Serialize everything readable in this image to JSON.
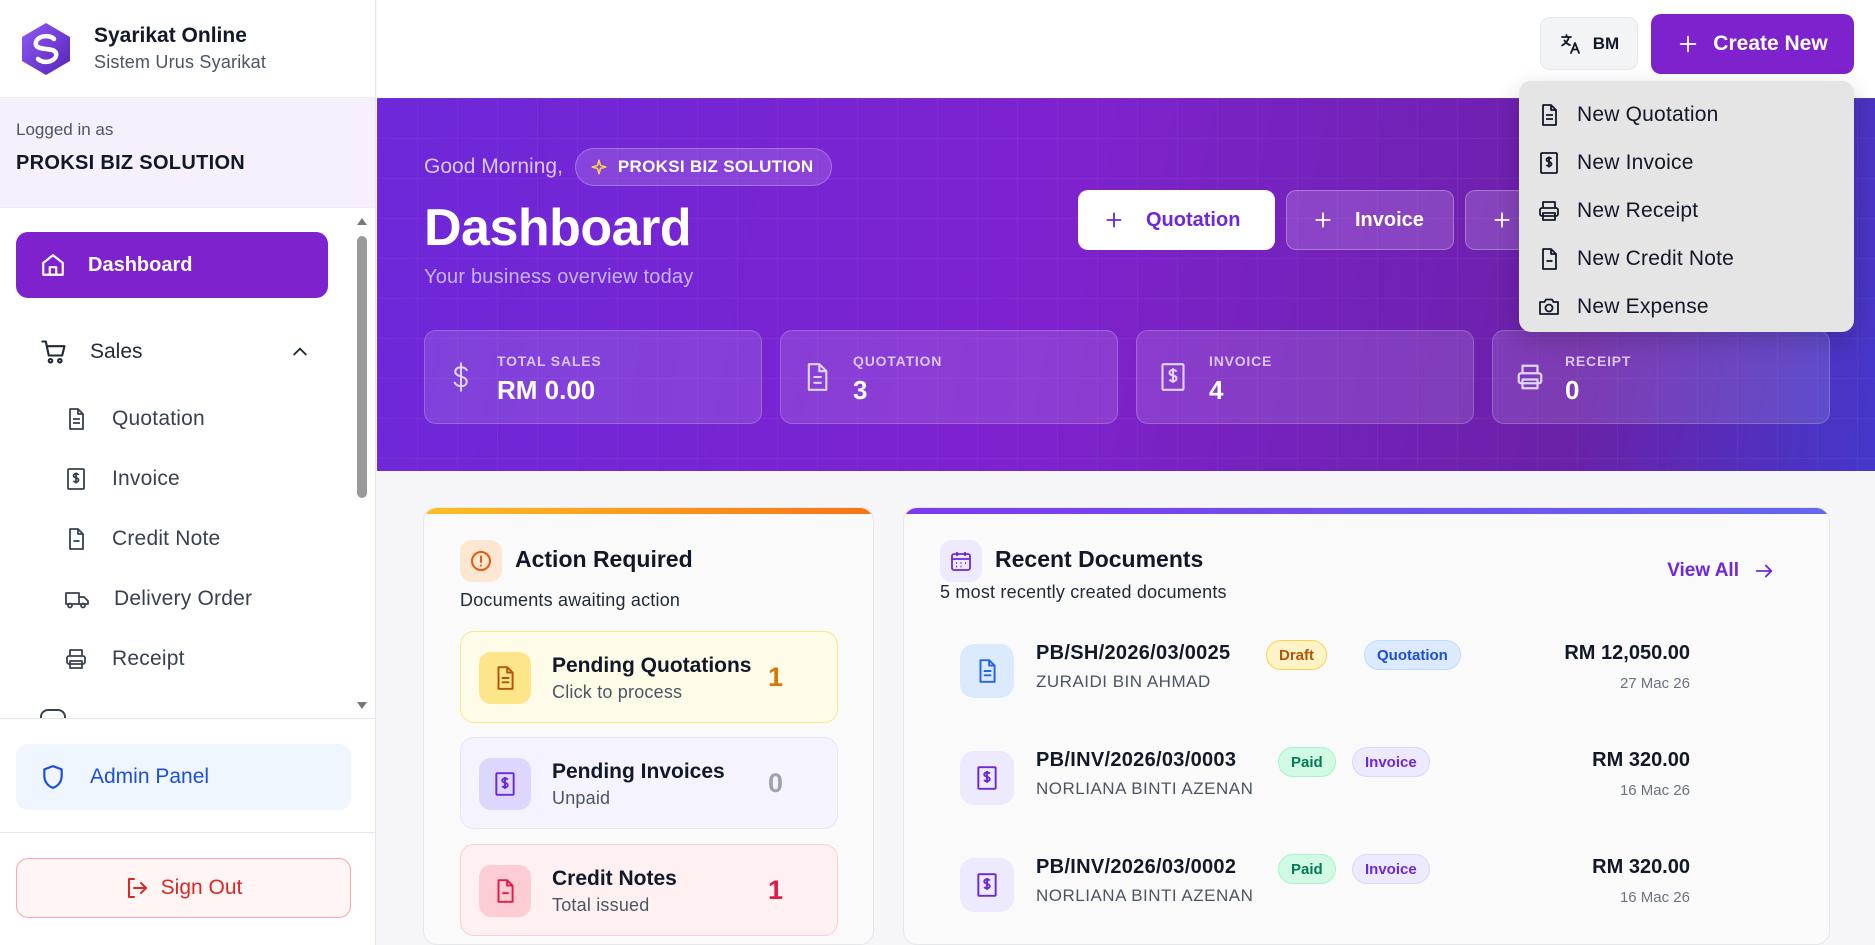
{
  "brand": {
    "name": "Syarikat Online",
    "subtitle": "Sistem Urus Syarikat"
  },
  "session": {
    "label": "Logged in as",
    "company": "PROKSI BIZ SOLUTION"
  },
  "nav": {
    "dashboard": "Dashboard",
    "sales": "Sales",
    "sales_items": [
      "Quotation",
      "Invoice",
      "Credit Note",
      "Delivery Order",
      "Receipt"
    ],
    "admin": "Admin Panel",
    "signout": "Sign Out"
  },
  "topbar": {
    "language": "BM",
    "create_new": "Create New"
  },
  "dropdown": {
    "items": [
      "New Quotation",
      "New Invoice",
      "New Receipt",
      "New Credit Note",
      "New Expense"
    ]
  },
  "hero": {
    "greeting": "Good Morning,",
    "company_badge": "PROKSI BIZ SOLUTION",
    "title": "Dashboard",
    "subtitle": "Your business overview today",
    "quick_actions": [
      "Quotation",
      "Invoice"
    ],
    "stats": [
      {
        "label": "TOTAL SALES",
        "value": "RM 0.00"
      },
      {
        "label": "QUOTATION",
        "value": "3"
      },
      {
        "label": "INVOICE",
        "value": "4"
      },
      {
        "label": "RECEIPT",
        "value": "0"
      }
    ]
  },
  "action_required": {
    "title": "Action Required",
    "subtitle": "Documents awaiting action",
    "items": [
      {
        "title": "Pending Quotations",
        "sub": "Click to process",
        "count": "1"
      },
      {
        "title": "Pending Invoices",
        "sub": "Unpaid",
        "count": "0"
      },
      {
        "title": "Credit Notes",
        "sub": "Total issued",
        "count": "1"
      }
    ]
  },
  "recent": {
    "title": "Recent Documents",
    "subtitle": "5 most recently created documents",
    "view_all": "View All",
    "docs": [
      {
        "number": "PB/SH/2026/03/0025",
        "status": "Draft",
        "type": "Quotation",
        "client": "ZURAIDI BIN AHMAD",
        "amount": "RM 12,050.00",
        "date": "27 Mac 26"
      },
      {
        "number": "PB/INV/2026/03/0003",
        "status": "Paid",
        "type": "Invoice",
        "client": "NORLIANA BINTI AZENAN",
        "amount": "RM 320.00",
        "date": "16 Mac 26"
      },
      {
        "number": "PB/INV/2026/03/0002",
        "status": "Paid",
        "type": "Invoice",
        "client": "NORLIANA BINTI AZENAN",
        "amount": "RM 320.00",
        "date": "16 Mac 26"
      }
    ]
  },
  "colors": {
    "accent": "#7e22ce",
    "danger": "#dc2626",
    "admin": "#1d4ed8"
  }
}
